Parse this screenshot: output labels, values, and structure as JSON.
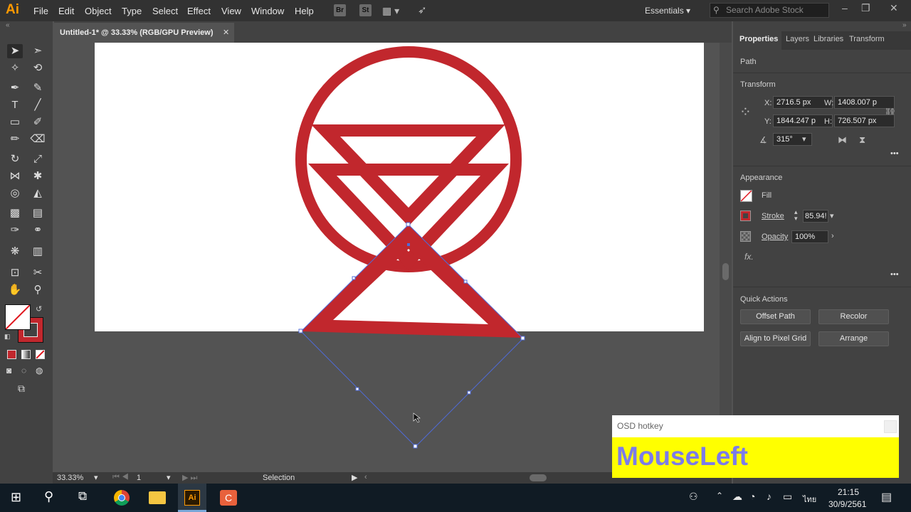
{
  "app": {
    "logo": "Ai",
    "menu": [
      "File",
      "Edit",
      "Object",
      "Type",
      "Select",
      "Effect",
      "View",
      "Window",
      "Help"
    ],
    "toolbar_badges": [
      "Br",
      "St"
    ],
    "workspace": "Essentials",
    "search_placeholder": "Search Adobe Stock",
    "window_controls": [
      "–",
      "❐",
      "✕"
    ]
  },
  "document": {
    "tab_title": "Untitled-1* @ 33.33% (RGB/GPU Preview)",
    "tab_close": "✕",
    "accent_color": "#c1272d",
    "selection_color": "#4f6bd9"
  },
  "status_bar": {
    "zoom": "33.33%",
    "artboard": "1",
    "tool": "Selection"
  },
  "properties_panel": {
    "tabs": [
      "Properties",
      "Layers",
      "Libraries",
      "Transform"
    ],
    "object_type": "Path",
    "transform": {
      "title": "Transform",
      "x_label": "X:",
      "x_value": "2716.5 px",
      "y_label": "Y:",
      "y_value": "1844.247 p",
      "w_label": "W:",
      "w_value": "1408.007 p",
      "h_label": "H:",
      "h_value": "726.507 px",
      "angle": "315°"
    },
    "appearance": {
      "title": "Appearance",
      "fill_label": "Fill",
      "stroke_label": "Stroke",
      "stroke_value": "85.94!",
      "opacity_label": "Opacity",
      "opacity_value": "100%",
      "fx": "fx."
    },
    "quick_actions": {
      "title": "Quick Actions",
      "buttons": [
        "Offset Path",
        "Recolor",
        "Align to Pixel Grid",
        "Arrange"
      ]
    },
    "more": "•••"
  },
  "osd": {
    "title": "OSD hotkey",
    "key": "MouseLeft",
    "background": "#ffff00",
    "text_color": "#7b7bea"
  },
  "taskbar": {
    "time": "21:15",
    "date": "30/9/2561",
    "language": "ไทย",
    "ai_label": "Ai"
  }
}
